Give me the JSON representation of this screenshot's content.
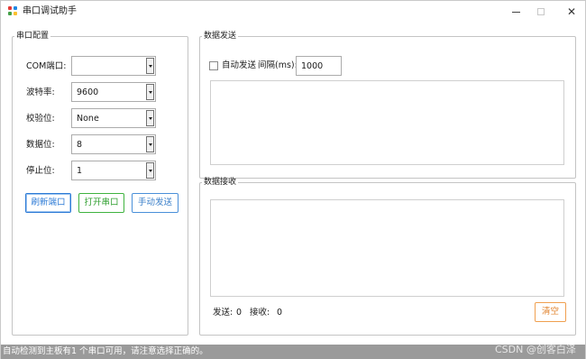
{
  "window": {
    "title": "串口调试助手",
    "icon": "app-grid-icon",
    "controls": {
      "minimize": "minimize-icon",
      "maximize": "maximize-icon",
      "close": "✕"
    }
  },
  "config": {
    "legend": "串口配置",
    "com_label": "COM端口:",
    "com_value": "",
    "baud_label": "波特率:",
    "baud_value": "9600",
    "parity_label": "校验位:",
    "parity_value": "None",
    "databits_label": "数据位:",
    "databits_value": "8",
    "stopbits_label": "停止位:",
    "stopbits_value": "1",
    "refresh_button": "刷新端口",
    "open_button": "打开串口",
    "manual_send_button": "手动发送"
  },
  "send": {
    "legend": "数据发送",
    "auto_send_label": "自动发送",
    "auto_send_checked": false,
    "interval_label": "间隔(ms):",
    "interval_value": "1000",
    "text": ""
  },
  "receive": {
    "legend": "数据接收",
    "text": "",
    "sent_label": "发送:",
    "sent_count": "0",
    "recv_label": "接收:",
    "recv_count": "0",
    "clear_button": "清空"
  },
  "status": {
    "message": "自动检测到主板有1 个串口可用，请注意选择正确的。"
  },
  "watermark": "CSDN @创客白泽",
  "colors": {
    "refresh_accent": "#2d7bd6",
    "open_accent": "#3fb33f",
    "send_accent": "#4a90d9",
    "clear_accent": "#f0a050",
    "statusbar": "#9a9a9a"
  }
}
